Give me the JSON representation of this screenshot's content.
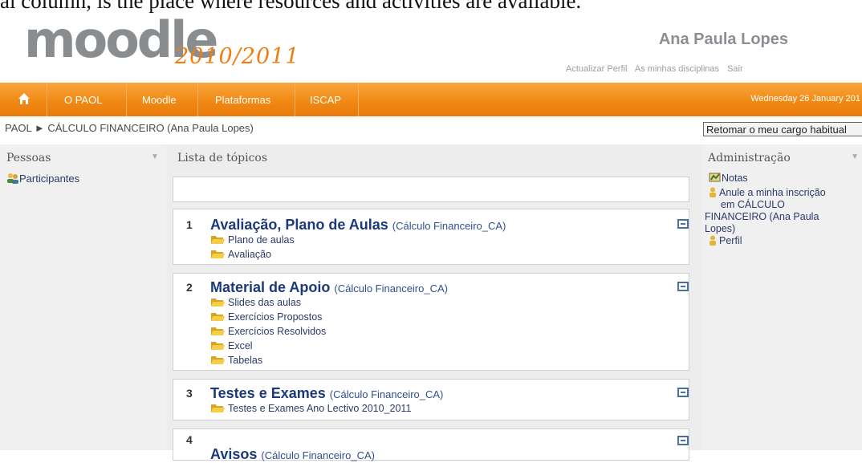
{
  "caption_top": "al column, is the place where resources and activities are available.",
  "logo": {
    "word": "moodle",
    "year": "2010/2011"
  },
  "user": {
    "name": "Ana Paula Lopes",
    "links": [
      "Actualizar Perfil",
      "As minhas disciplinas",
      "Sair"
    ]
  },
  "nav": {
    "items": [
      "O PAOL",
      "Moodle",
      "Plataformas",
      "ISCAP"
    ],
    "date": "Wednesday 26 January 201"
  },
  "breadcrumb": {
    "root": "PAOL",
    "arrow": "►",
    "current": "CÁLCULO FINANCEIRO (Ana Paula Lopes)"
  },
  "role_button": "Retomar o meu cargo habitual",
  "left_block": {
    "title": "Pessoas",
    "items": [
      "Participantes"
    ]
  },
  "center": {
    "title": "Lista de tópicos",
    "topics": [
      {
        "num": "1",
        "title": "Avaliação, Plano de Aulas",
        "sub": "(Cálculo Financeiro_CA)",
        "items": [
          "Plano de aulas",
          "Avaliação"
        ]
      },
      {
        "num": "2",
        "title": "Material de Apoio",
        "sub": "(Cálculo Financeiro_CA)",
        "items": [
          "Slides das aulas",
          "Exercícios Propostos",
          "Exercícios Resolvidos",
          "Excel",
          "Tabelas"
        ]
      },
      {
        "num": "3",
        "title": "Testes e Exames",
        "sub": "(Cálculo Financeiro_CA)",
        "items": [
          "Testes e Exames Ano Lectivo 2010_2011"
        ]
      },
      {
        "num": "4",
        "title": "Avisos",
        "sub": "(Cálculo Financeiro_CA)",
        "items": []
      }
    ]
  },
  "right_block": {
    "title": "Administração",
    "notas": "Notas",
    "anule_1": "Anule a minha inscrição",
    "anule_2": "em CÁLCULO",
    "anule_3": "FINANCEIRO (Ana Paula",
    "anule_4": "Lopes)",
    "perfil": "Perfil"
  },
  "colors": {
    "nav_orange": "#f18a14",
    "link_blue": "#1c3a7a",
    "logo_gray": "#8a8d90"
  }
}
